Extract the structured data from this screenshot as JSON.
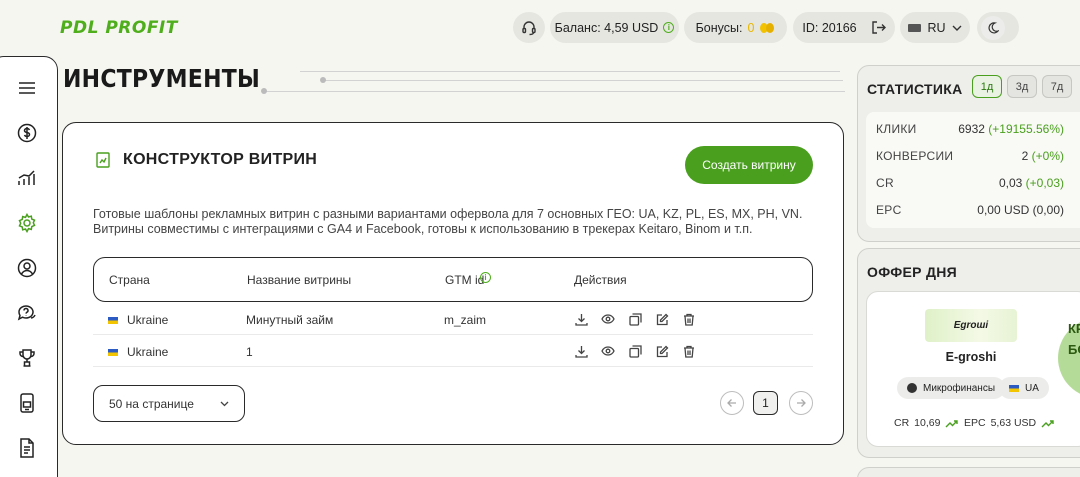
{
  "header": {
    "logo": "PDL PROFIT",
    "balance_label": "Баланс: 4,59 USD",
    "bonus_label": "Бонусы:",
    "bonus_value": "0",
    "user_id": "ID: 20166",
    "language": "RU"
  },
  "page": {
    "title": "ИНСТРУМЕНТЫ"
  },
  "constructor": {
    "title": "КОНСТРУКТОР ВИТРИН",
    "create_button": "Создать витрину",
    "description": "Готовые шаблоны рекламных витрин с разными вариантами офервола для 7 основных ГЕО: UA, KZ, PL, ES, MX, PH, VN. Витрины совместимы с интеграциями с GA4 и Facebook, готовы к использованию в трекерах Keitaro, Binom и т.п.",
    "columns": {
      "country": "Страна",
      "name": "Название витрины",
      "gtm": "GTM id",
      "actions": "Действия"
    },
    "rows": [
      {
        "country": "Ukraine",
        "name": "Минутный займ",
        "gtm": "m_zaim"
      },
      {
        "country": "Ukraine",
        "name": "1",
        "gtm": ""
      }
    ],
    "per_page": "50 на странице",
    "current_page": "1"
  },
  "stats": {
    "title": "СТАТИСТИКА",
    "periods": [
      "1д",
      "3д",
      "7д"
    ],
    "active_period": "1д",
    "rows": [
      {
        "label": "КЛИКИ",
        "value": "6932",
        "delta": "(+19155.56%)"
      },
      {
        "label": "КОНВЕРСИИ",
        "value": "2",
        "delta": "(+0%)"
      },
      {
        "label": "CR",
        "value": "0,03",
        "delta": "(+0,03)"
      },
      {
        "label": "EPC",
        "value": "0,00 USD",
        "delta": "(0,00)"
      }
    ]
  },
  "offer": {
    "title": "ОФФЕР ДНЯ",
    "logo_text": "Egroші",
    "name": "E-groshi",
    "category": "Микрофинансы",
    "geo": "UA",
    "cr_label": "CR",
    "cr_value": "10,69",
    "epc_label": "EPC",
    "epc_value": "5,63 USD",
    "badge_line1": "КРУ",
    "badge_line2": "БО"
  },
  "colors": {
    "accent": "#4aa01e",
    "background": "#f6f6f1"
  },
  "icons": {
    "sidebar": [
      "menu-icon",
      "dollar-icon",
      "chart-icon",
      "gear-icon",
      "user-icon",
      "faq-icon",
      "trophy-icon",
      "phone-icon",
      "document-icon"
    ]
  }
}
